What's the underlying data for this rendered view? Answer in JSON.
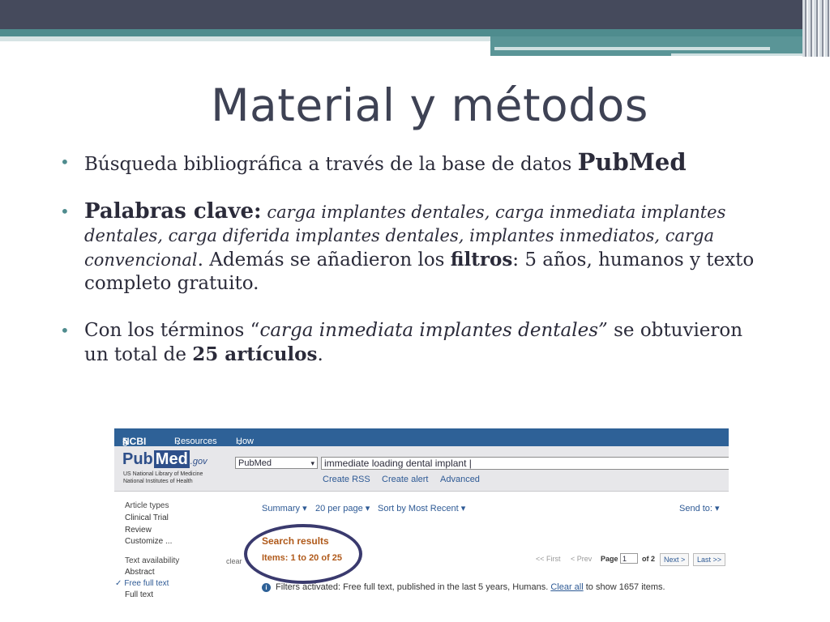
{
  "slide": {
    "title": "Material y métodos",
    "bullet1": {
      "text": "Búsqueda bibliográfica a través de la base de datos ",
      "pubmed": "PubMed"
    },
    "bullet2": {
      "label": "Palabras clave:",
      "keywords": " carga implantes dentales,  carga inmediata implantes dentales, carga diferida implantes dentales, implantes inmediatos, carga convencional",
      "text_a": ". Además se añadieron los ",
      "filters_word": "filtros",
      "text_b": ": 5 años, humanos y texto completo gratuito."
    },
    "bullet3": {
      "text_a": "Con los términos “",
      "terms": "carga inmediata implantes dentales”",
      "text_b": " se obtuvieron un total de ",
      "count": "25 artículos",
      "text_c": "."
    }
  },
  "pubmed_shot": {
    "topbar": {
      "ncbi": "NCBI",
      "resources": "Resources",
      "howto": "How To"
    },
    "logo": {
      "pub": "Pub",
      "med": "Med",
      "gov": ".gov",
      "sub1": "US National Library of Medicine",
      "sub2": "National Institutes of Health"
    },
    "database": "PubMed",
    "query": "immediate loading dental implant",
    "links": {
      "rss": "Create RSS",
      "alert": "Create alert",
      "advanced": "Advanced"
    },
    "sidebar": {
      "article_types": "Article types",
      "clinical_trial": "Clinical Trial",
      "review": "Review",
      "customize": "Customize ...",
      "text_availability": "Text availability",
      "abstract": "Abstract",
      "free_full_text": "Free full text",
      "full_text": "Full text",
      "clear": "clear"
    },
    "toolbar": {
      "summary": "Summary",
      "per_page": "20 per page",
      "sort": "Sort by Most Recent",
      "send_to": "Send to:"
    },
    "results": {
      "title": "Search results",
      "items": "Items: 1 to 20 of 25"
    },
    "pager": {
      "first": "<< First",
      "prev": "< Prev",
      "page": "Page",
      "current": "1",
      "of": "of 2",
      "next": "Next >",
      "last": "Last >>"
    },
    "filters": {
      "text": "Filters activated: Free full text, published in the last 5 years, Humans. ",
      "clear_all": "Clear all",
      "tail": " to show 1657 items."
    }
  }
}
